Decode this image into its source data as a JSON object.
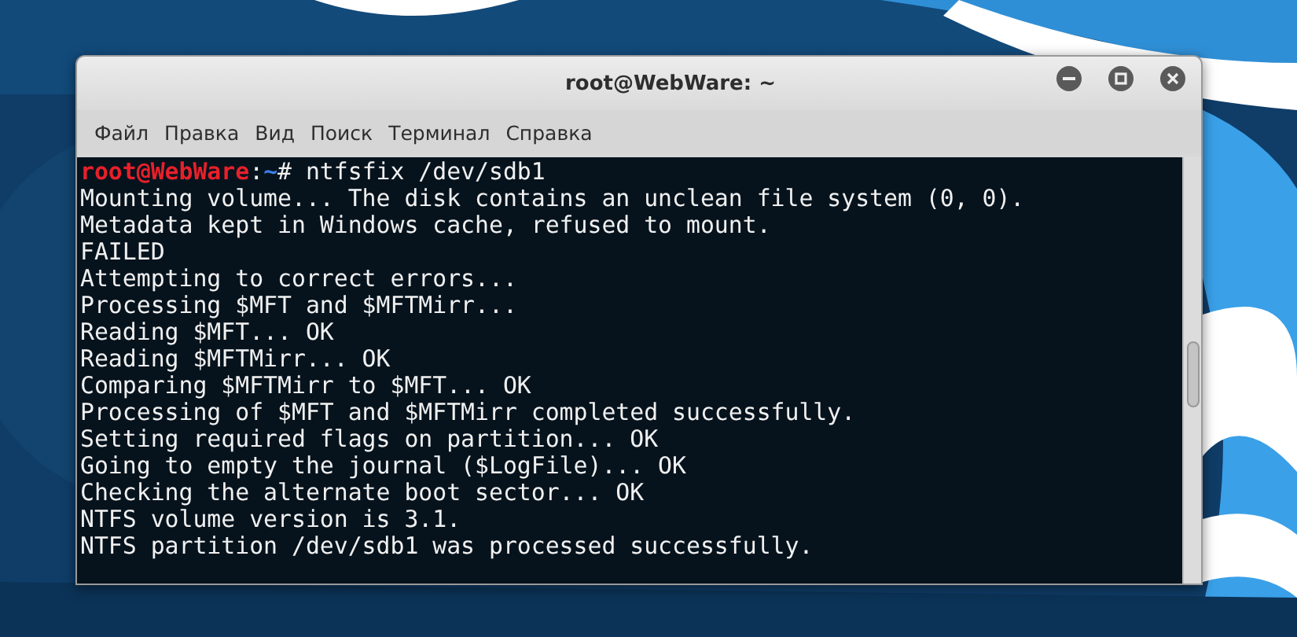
{
  "window": {
    "title": "root@WebWare: ~"
  },
  "menu": [
    "Файл",
    "Правка",
    "Вид",
    "Поиск",
    "Терминал",
    "Справка"
  ],
  "terminal": {
    "prompt": {
      "user_host": "root@WebWare",
      "separator": ":",
      "path": "~",
      "command": "# ntfsfix /dev/sdb1"
    },
    "lines": [
      "Mounting volume... The disk contains an unclean file system (0, 0).",
      "Metadata kept in Windows cache, refused to mount.",
      "FAILED",
      "Attempting to correct errors...",
      "Processing $MFT and $MFTMirr...",
      "Reading $MFT... OK",
      "Reading $MFTMirr... OK",
      "Comparing $MFTMirr to $MFT... OK",
      "Processing of $MFT and $MFTMirr completed successfully.",
      "Setting required flags on partition... OK",
      "Going to empty the journal ($LogFile)... OK",
      "Checking the alternate boot sector... OK",
      "NTFS volume version is 3.1.",
      "NTFS partition /dev/sdb1 was processed successfully."
    ]
  }
}
